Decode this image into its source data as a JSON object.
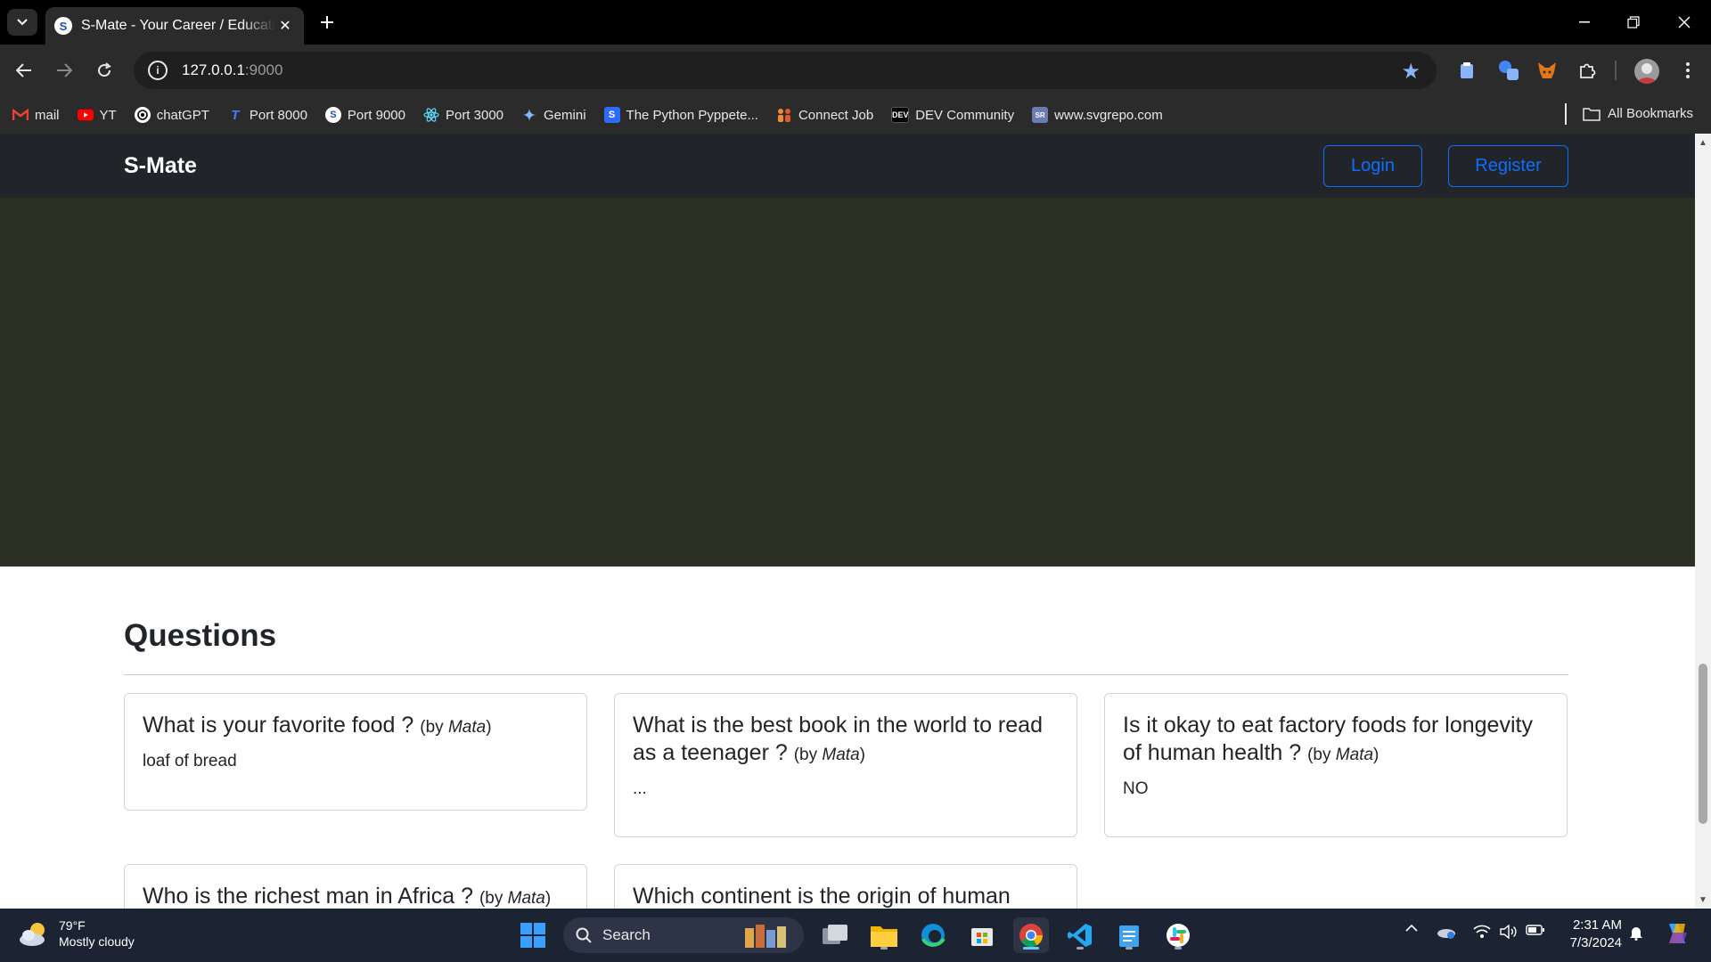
{
  "browser": {
    "tab": {
      "title": "S-Mate - Your Career / Education",
      "favicon": "S"
    },
    "url": {
      "host": "127.0.0.1",
      "port": ":9000"
    },
    "bookmarks": [
      {
        "label": "mail",
        "icon": "gmail-icon",
        "color": "#ea4335"
      },
      {
        "label": "YT",
        "icon": "youtube-icon",
        "color": "#ff0000"
      },
      {
        "label": "chatGPT",
        "icon": "openai-icon",
        "color": "#ffffff"
      },
      {
        "label": "Port 8000",
        "icon": "typo3-icon",
        "color": "#3b82f6"
      },
      {
        "label": "Port 9000",
        "icon": "smate-icon",
        "color": "#1f4fbf"
      },
      {
        "label": "Port 3000",
        "icon": "react-icon",
        "color": "#61dafb"
      },
      {
        "label": "Gemini",
        "icon": "gemini-icon",
        "color": "#8ab4f8"
      },
      {
        "label": "The Python Pyppete...",
        "icon": "pyppeteer-icon",
        "color": "#2f6bff"
      },
      {
        "label": "Connect Job",
        "icon": "people-icon",
        "color": "#f28b30"
      },
      {
        "label": "DEV Community",
        "icon": "dev-icon",
        "color": "#000000"
      },
      {
        "label": "www.svgrepo.com",
        "icon": "svgrepo-icon",
        "color": "#6b7bb5"
      }
    ],
    "all_bookmarks": "All Bookmarks"
  },
  "page": {
    "brand": "S-Mate",
    "nav": {
      "login": "Login",
      "register": "Register"
    },
    "accent": "#0d6efd",
    "hero_color": "#2c3024",
    "questions_heading": "Questions",
    "questions": [
      {
        "title": "What is your favorite food ?",
        "by_prefix": "(by",
        "author": "Mata",
        "by_suffix": ")",
        "answer": "loaf of bread"
      },
      {
        "title": "What is the best book in the world to read as a teenager ?",
        "by_prefix": "(by",
        "author": "Mata",
        "by_suffix": ")",
        "answer": "..."
      },
      {
        "title": "Is it okay to eat factory foods for longevity of human health ?",
        "by_prefix": "(by",
        "author": "Mata",
        "by_suffix": ")",
        "answer": "NO"
      },
      {
        "title": "Who is the richest man in Africa ?",
        "by_prefix": "(by",
        "author": "Mata",
        "by_suffix": ")",
        "answer": ""
      },
      {
        "title": "Which continent is the origin of human",
        "by_prefix": "",
        "author": "",
        "by_suffix": "",
        "answer": ""
      }
    ]
  },
  "taskbar": {
    "weather": {
      "temp": "79°F",
      "condition": "Mostly cloudy"
    },
    "search_placeholder": "Search",
    "clock": {
      "time": "2:31 AM",
      "date": "7/3/2024"
    }
  }
}
